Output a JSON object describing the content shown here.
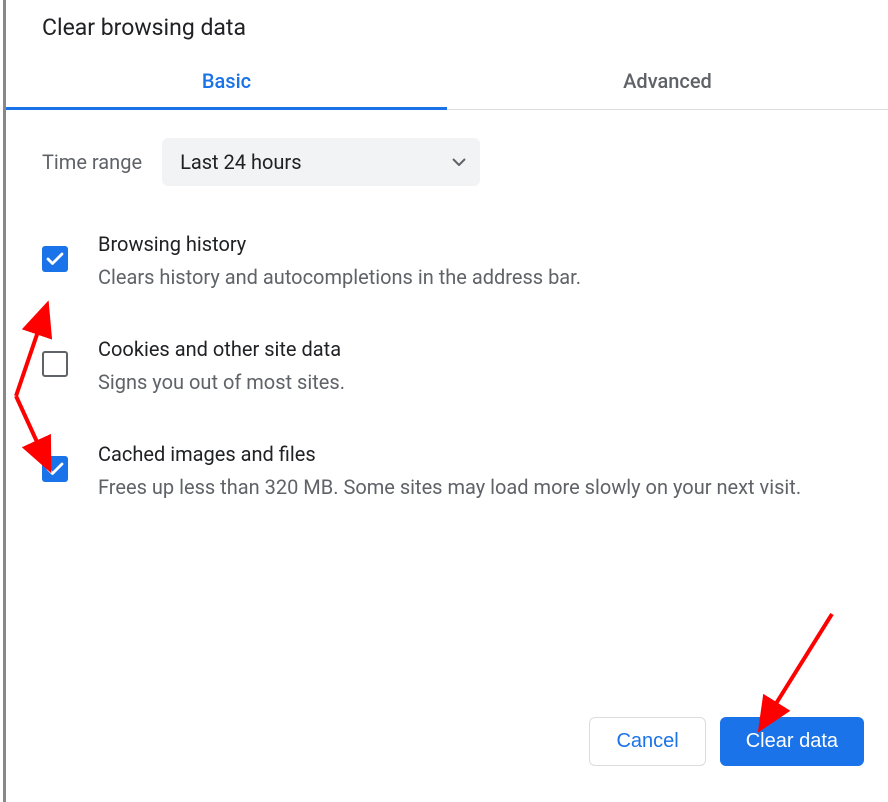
{
  "dialog": {
    "title": "Clear browsing data"
  },
  "tabs": {
    "basic": "Basic",
    "advanced": "Advanced"
  },
  "time_range": {
    "label": "Time range",
    "value": "Last 24 hours"
  },
  "options": {
    "browsing_history": {
      "title": "Browsing history",
      "desc": "Clears history and autocompletions in the address bar.",
      "checked": true
    },
    "cookies": {
      "title": "Cookies and other site data",
      "desc": "Signs you out of most sites.",
      "checked": false
    },
    "cache": {
      "title": "Cached images and files",
      "desc": "Frees up less than 320 MB. Some sites may load more slowly on your next visit.",
      "checked": true
    }
  },
  "buttons": {
    "cancel": "Cancel",
    "clear": "Clear data"
  },
  "colors": {
    "accent": "#1a73e8",
    "text_primary": "#202124",
    "text_secondary": "#5f6368",
    "annotation": "#ff0000"
  }
}
